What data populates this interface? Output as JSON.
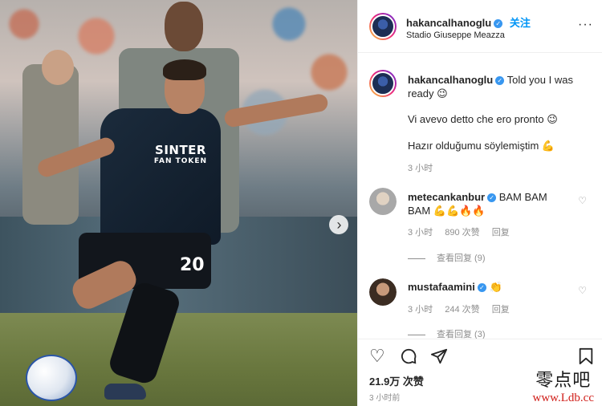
{
  "post": {
    "username": "hakancalhanoglu",
    "verified_mark": "✓",
    "follow_label": "关注",
    "location": "Stadio Giuseppe Meazza",
    "more_label": "···",
    "photo": {
      "sponsor_line1": "SINTER",
      "sponsor_line2": "FAN TOKEN",
      "shirt_number": "20",
      "next_label": "›"
    }
  },
  "caption": {
    "username": "hakancalhanoglu",
    "line1": "Told you I was ready 😉",
    "line2": "Vi avevo detto che ero pronto 😉",
    "line3": "Hazır olduğumu söylemiştim 💪",
    "time": "3 小时"
  },
  "comments": [
    {
      "username": "metecankanbur",
      "text": "BAM BAM BAM 💪💪🔥🔥",
      "time": "3 小时",
      "likes": "890 次赞",
      "reply_label": "回复",
      "view_replies": "查看回复 (9)"
    },
    {
      "username": "mustafaamini",
      "text": "👏",
      "time": "3 小时",
      "likes": "244 次赞",
      "reply_label": "回复",
      "view_replies": "查看回复 (3)"
    }
  ],
  "actions": {
    "like_icon": "heart-icon",
    "comment_icon": "comment-icon",
    "share_icon": "send-icon",
    "save_icon": "bookmark-icon",
    "likes": "21.9万 次赞",
    "time_ago": "3 小时前"
  },
  "watermark": {
    "text": "零点吧",
    "url": "www.Ldb.cc"
  },
  "colors": {
    "accent": "#0095f6",
    "verified": "#3897f0",
    "muted": "#8e8e8e"
  }
}
